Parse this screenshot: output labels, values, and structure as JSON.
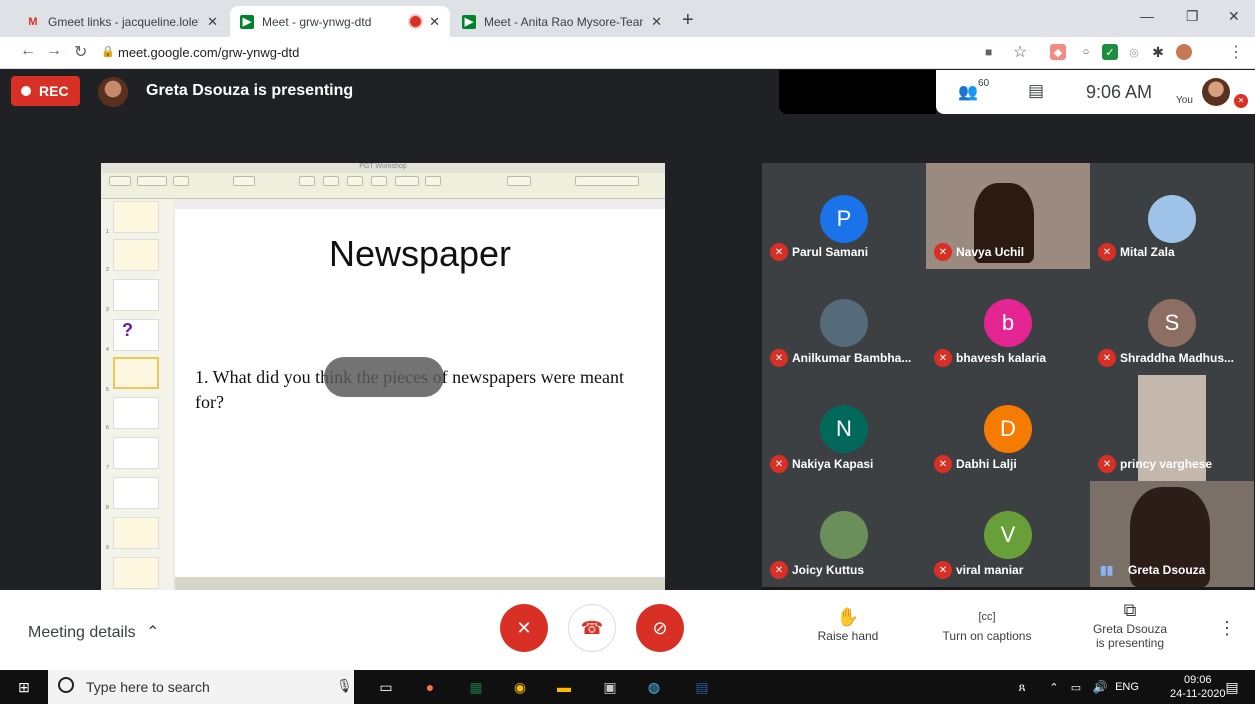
{
  "browser": {
    "tabs": [
      {
        "title": "Gmeet links - jacqueline.loleta@",
        "favicon": "gmail-icon"
      },
      {
        "title": "Meet - grw-ynwg-dtd",
        "favicon": "meet-icon"
      },
      {
        "title": "Meet - Anita Rao Mysore-Team E",
        "favicon": "meet-icon"
      }
    ],
    "url": "meet.google.com/grw-ynwg-dtd"
  },
  "meet": {
    "rec_label": "REC",
    "presenting_text": "Greta Dsouza is presenting",
    "participant_count": "60",
    "time": "9:06 AM",
    "you_label": "You",
    "meeting_details": "Meeting details",
    "raise_hand": "Raise hand",
    "captions": "Turn on captions",
    "presenting_line1": "Greta Dsouza",
    "presenting_line2": "is presenting"
  },
  "slide": {
    "window_title": "PGT Workshop",
    "title": "Newspaper",
    "question": "1. What did you think the pieces of newspapers were meant for?",
    "thumb_numbers": [
      "1",
      "2",
      "3",
      "4",
      "5",
      "6",
      "7",
      "8",
      "9"
    ]
  },
  "participants": [
    {
      "name": "Parul Samani",
      "initial": "P",
      "color": "#1a73e8"
    },
    {
      "name": "Navya Uchil",
      "initial": "",
      "color": ""
    },
    {
      "name": "Mital Zala",
      "initial": "",
      "color": ""
    },
    {
      "name": "Anilkumar Bambha...",
      "initial": "",
      "color": ""
    },
    {
      "name": "bhavesh kalaria",
      "initial": "b",
      "color": "#e52592"
    },
    {
      "name": "Shraddha Madhus...",
      "initial": "S",
      "color": "#8d6e63"
    },
    {
      "name": "Nakiya Kapasi",
      "initial": "N",
      "color": "#00695c"
    },
    {
      "name": "Dabhi Lalji",
      "initial": "D",
      "color": "#f57c00"
    },
    {
      "name": "princy varghese",
      "initial": "",
      "color": ""
    },
    {
      "name": "Joicy Kuttus",
      "initial": "",
      "color": ""
    },
    {
      "name": "viral maniar",
      "initial": "V",
      "color": "#689f38"
    },
    {
      "name": "Greta Dsouza",
      "initial": "",
      "color": ""
    }
  ],
  "taskbar": {
    "search_placeholder": "Type here to search",
    "lang": "ENG",
    "time": "09:06",
    "date": "24-11-2020"
  },
  "colors": {
    "accent_red": "#d93025",
    "meet_blue": "#8ab4f8"
  }
}
